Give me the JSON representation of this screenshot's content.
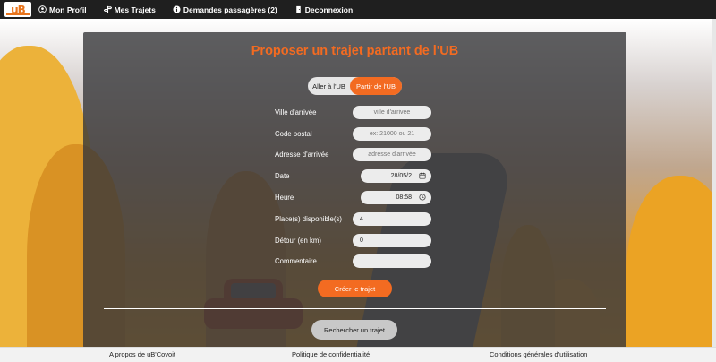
{
  "nav": {
    "logo_text": "uB",
    "items": [
      {
        "label": "Mon Profil",
        "icon": "user-circle-icon"
      },
      {
        "label": "Mes Trajets",
        "icon": "route-icon"
      },
      {
        "label": "Demandes passagères (2)",
        "icon": "info-circle-icon"
      },
      {
        "label": "Deconnexion",
        "icon": "door-icon"
      }
    ]
  },
  "form": {
    "title": "Proposer un trajet partant de l'UB",
    "toggle": {
      "option1": "Aller à l'UB",
      "option2": "Partir de l'UB",
      "selected": "Partir de l'UB"
    },
    "fields": {
      "ville": {
        "label": "Ville d'arrivée",
        "placeholder": "ville d'arrivée"
      },
      "code_postal": {
        "label": "Code postal",
        "placeholder": "ex: 21000 ou 21"
      },
      "adresse": {
        "label": "Adresse d'arrivée",
        "placeholder": "adresse d'arrivée"
      },
      "date": {
        "label": "Date",
        "value": "28/05/2"
      },
      "heure": {
        "label": "Heure",
        "value": "08:58"
      },
      "places": {
        "label": "Place(s) disponible(s)",
        "value": "4"
      },
      "detour": {
        "label": "Détour (en km)",
        "value": "0"
      },
      "commentaire": {
        "label": "Commentaire",
        "value": ""
      }
    },
    "create_button": "Créer le trajet",
    "search_button": "Rechercher un trajet"
  },
  "footer": {
    "about": "A propos de uB'Covoit",
    "privacy": "Politique de confidentialité",
    "terms": "Conditions générales d'utilisation"
  },
  "colors": {
    "accent": "#f36b21",
    "navbar": "#1f1f1f"
  }
}
